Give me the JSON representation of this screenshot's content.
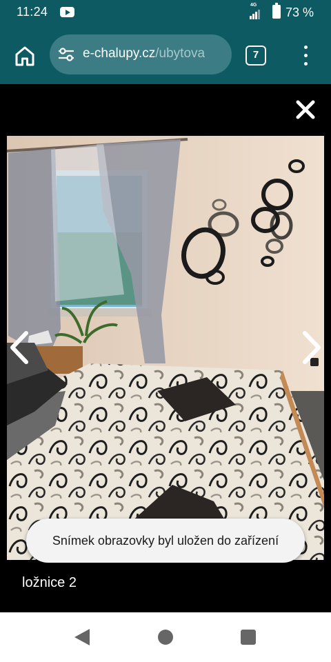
{
  "status_bar": {
    "time": "11:24",
    "network_type": "4G",
    "battery_percent": "73 %",
    "notification_icon": "youtube-icon",
    "colors": {
      "background": "#0e5a63"
    }
  },
  "browser": {
    "url_domain": "e-chalupy.cz",
    "url_path": "/ubytova",
    "tab_count": "7",
    "icons": [
      "home-icon",
      "site-settings-icon",
      "more-vertical-icon"
    ]
  },
  "gallery": {
    "caption": "ložnice 2",
    "icons": [
      "close-icon",
      "chevron-left-icon",
      "chevron-right-icon"
    ],
    "photo_alt": "bedroom photo"
  },
  "toast": {
    "message": "Snímek obrazovky byl uložen do zařízení"
  },
  "system_nav": {
    "icons": [
      "back-icon",
      "home-circle-icon",
      "recents-icon"
    ]
  }
}
